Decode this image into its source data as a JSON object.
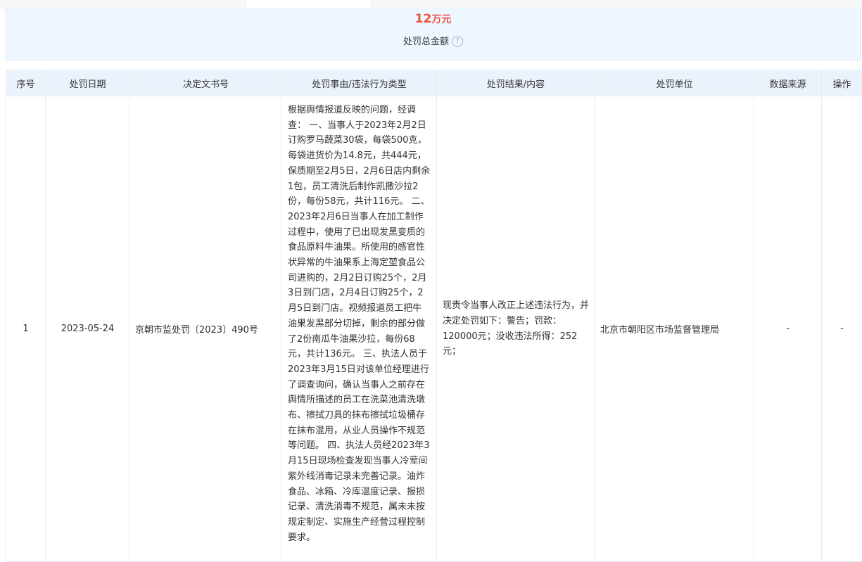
{
  "summary": {
    "amount_value": "12",
    "amount_unit": "万元",
    "amount_label": "处罚总金额",
    "help_glyph": "?"
  },
  "table": {
    "headers": [
      "序号",
      "处罚日期",
      "决定文书号",
      "处罚事由/违法行为类型",
      "处罚结果/内容",
      "处罚单位",
      "数据来源",
      "操作"
    ],
    "rows": [
      {
        "index": "1",
        "date": "2023-05-24",
        "doc_no": "京朝市监处罚〔2023〕490号",
        "reason": "根据舆情报道反映的问题，经调查： 一、当事人于2023年2月2日订购罗马蔬菜30袋，每袋500克，每袋进货价为14.8元，共444元，保质期至2月5日，2月6日店内剩余1包，员工清洗后制作凯撒沙拉2份，每份58元，共计116元。 二、2023年2月6日当事人在加工制作过程中，使用了已出现发黑变质的食品原料牛油果。所使用的感官性状异常的牛油果系上海定堃食品公司进购的，2月2日订购25个，2月3日到门店，2月4日订购25个，2月5日到门店。视频报道员工把牛油果发黑部分切掉，剩余的部分做了2份南瓜牛油果沙拉，每份68元，共计136元。 三、执法人员于2023年3月15日对该单位经理进行了调查询问，确认当事人之前存在舆情所描述的员工在洗菜池清洗墩布、擦拭刀具的抹布擦拭垃圾桶存在抹布混用，从业人员操作不规范等问题。 四、执法人员经2023年3月15日现场检查发现当事人冷荤间紫外线消毒记录未完善记录。油炸食品、冰箱、冷库温度记录、报损记录、清洗消毒不规范，属未未按规定制定、实施生产经营过程控制要求。",
        "result": "现责令当事人改正上述违法行为，并决定处罚如下：警告；罚款：120000元；没收违法所得：252元；",
        "authority": "北京市朝阳区市场监督管理局",
        "source": "-",
        "action": "-"
      }
    ]
  }
}
